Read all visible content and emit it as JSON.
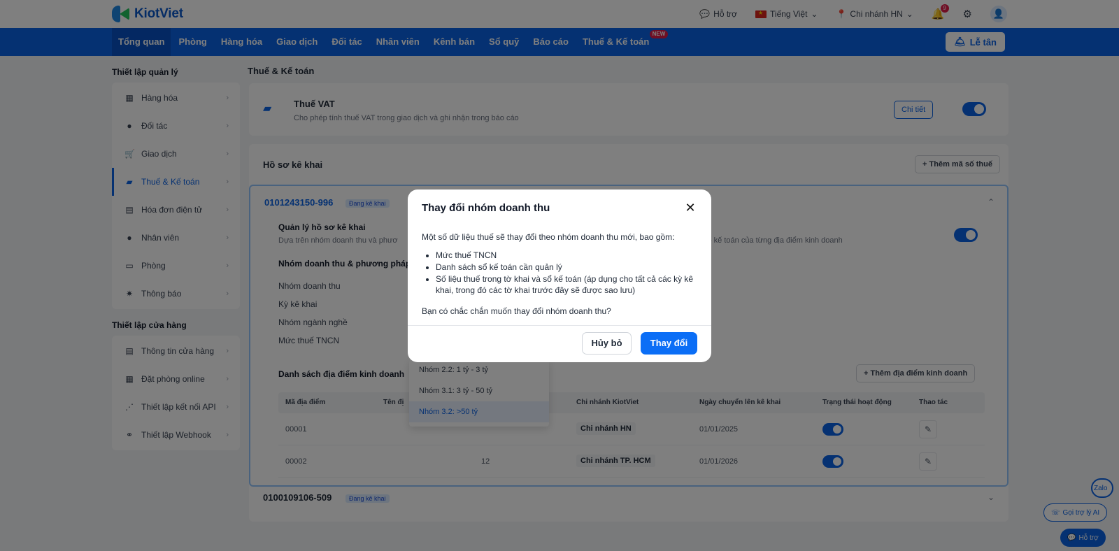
{
  "topbar": {
    "brand": "KiotViet",
    "support": "Hỗ trợ",
    "language": "Tiếng Việt",
    "branch": "Chi nhánh HN",
    "notification_count": "9"
  },
  "nav": {
    "items": [
      "Tổng quan",
      "Phòng",
      "Hàng hóa",
      "Giao dịch",
      "Đối tác",
      "Nhân viên",
      "Kênh bán",
      "Sổ quỹ",
      "Báo cáo",
      "Thuế & Kế toán"
    ],
    "new_badge": "NEW",
    "reception": "Lễ tân"
  },
  "sidebar": {
    "section1": "Thiết lập quản lý",
    "items1": [
      "Hàng hóa",
      "Đối tác",
      "Giao dịch",
      "Thuế & Kế toán",
      "Hóa đơn điện tử",
      "Nhân viên",
      "Phòng",
      "Thông báo"
    ],
    "section2": "Thiết lập cửa hàng",
    "items2": [
      "Thông tin cửa hàng",
      "Đặt phòng online",
      "Thiết lập kết nối API",
      "Thiết lập Webhook"
    ]
  },
  "content": {
    "title": "Thuế & Kế toán",
    "vat": {
      "title": "Thuế VAT",
      "desc": "Cho phép tính thuế VAT trong giao dịch và ghi nhận trong báo cáo",
      "detail_button": "Chi tiết"
    },
    "declaration": {
      "title": "Hồ sơ kê khai",
      "add_tax_button": "Thêm mã số thuế",
      "profile_id": "0101243150-996",
      "status": "Đang kê khai",
      "manage_title": "Quản lý hồ sơ kê khai",
      "manage_desc_left": "Dựa trên nhóm doanh thu và phươ",
      "manage_desc_right": "sổ kế toán của từng địa điểm kinh doanh",
      "group_section": "Nhóm doanh thu & phương pháp t",
      "fields": [
        "Nhóm doanh thu",
        "Kỳ kê khai",
        "Nhóm ngành nghề",
        "Mức thuế TNCN"
      ],
      "locations_title": "Danh sách địa điểm kinh doanh",
      "add_location_button": "Thêm địa điểm kinh doanh",
      "table_headers": [
        "Mã địa điểm",
        "Tên đị",
        "Chi nhánh KiotViet",
        "Ngày chuyển lên kê khai",
        "Trạng thái hoạt động",
        "Thao tác"
      ],
      "rows": [
        {
          "code": "00001",
          "mid": "",
          "branch": "Chi nhánh HN",
          "date": "01/01/2025"
        },
        {
          "code": "00002",
          "mid": "12",
          "branch": "Chi nhánh TP. HCM",
          "date": "01/01/2026"
        }
      ],
      "dropdown_options": [
        "Nhóm 2.2: 1 tỷ - 3 tỷ",
        "Nhóm 3.1: 3 tỷ - 50 tỷ",
        "Nhóm 3.2: >50 tỷ"
      ],
      "profile2_id": "0100109106-509",
      "profile2_status": "Đang kê khai"
    }
  },
  "floating": {
    "zalo": "Zalo",
    "ai": "Gọi trợ lý AI",
    "support": "Hỗ trợ"
  },
  "modal": {
    "title": "Thay đổi nhóm doanh thu",
    "intro": "Một số dữ liệu thuế sẽ thay đổi theo nhóm doanh thu mới, bao gồm:",
    "bullets": [
      "Mức thuế TNCN",
      "Danh sách sổ kế toán cần quản lý",
      "Số liệu thuế trong tờ khai và sổ kế toán (áp dụng cho tất cả các kỳ kê khai, trong đó các tờ khai trước đây sẽ được sao lưu)"
    ],
    "question": "Bạn có chắc chắn muốn thay đổi nhóm doanh thu?",
    "cancel": "Hủy bỏ",
    "confirm": "Thay đổi"
  }
}
